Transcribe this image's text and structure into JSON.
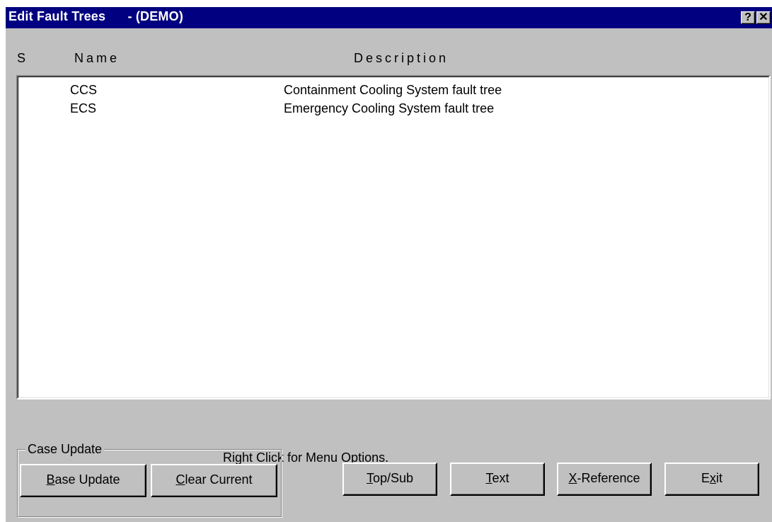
{
  "window": {
    "title": "Edit Fault Trees      - (DEMO)",
    "help_button": "?",
    "close_button": "✕"
  },
  "columns": {
    "status": "S",
    "name": "Name",
    "description": "Description"
  },
  "rows": [
    {
      "status": "",
      "name": "CCS",
      "description": "Containment Cooling System fault tree"
    },
    {
      "status": "",
      "name": "ECS",
      "description": "Emergency Cooling System fault tree"
    }
  ],
  "hint": "Right Click for Menu Options.",
  "case_update": {
    "label": "Case Update",
    "base_update": {
      "mnemonic": "B",
      "rest": "ase Update"
    },
    "clear_current": {
      "mnemonic": "C",
      "rest": "lear Current"
    }
  },
  "buttons": {
    "top_sub": {
      "mnemonic": "T",
      "rest": "op/Sub"
    },
    "text": {
      "mnemonic": "T",
      "rest": "ext"
    },
    "x_reference": {
      "mnemonic": "X",
      "rest": "-Reference"
    },
    "exit": {
      "pre": "E",
      "mnemonic": "x",
      "rest": "it"
    }
  },
  "colors": {
    "titlebar": "#000080",
    "face": "#c0c0c0",
    "list_bg": "#ffffff"
  }
}
